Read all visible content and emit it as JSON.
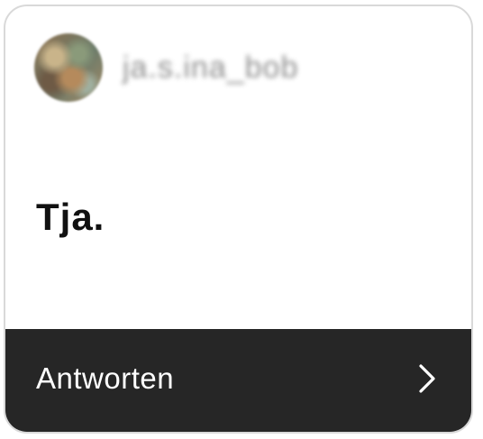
{
  "story_reply": {
    "username": "ja.s.ina_bob",
    "avatar_icon": "profile-avatar",
    "message": "Tja.",
    "reply_label": "Antworten",
    "reply_icon": "chevron-right-icon"
  },
  "colors": {
    "reply_bar_bg": "#262626",
    "card_border": "#d9d9d9",
    "message_text": "#111111"
  }
}
